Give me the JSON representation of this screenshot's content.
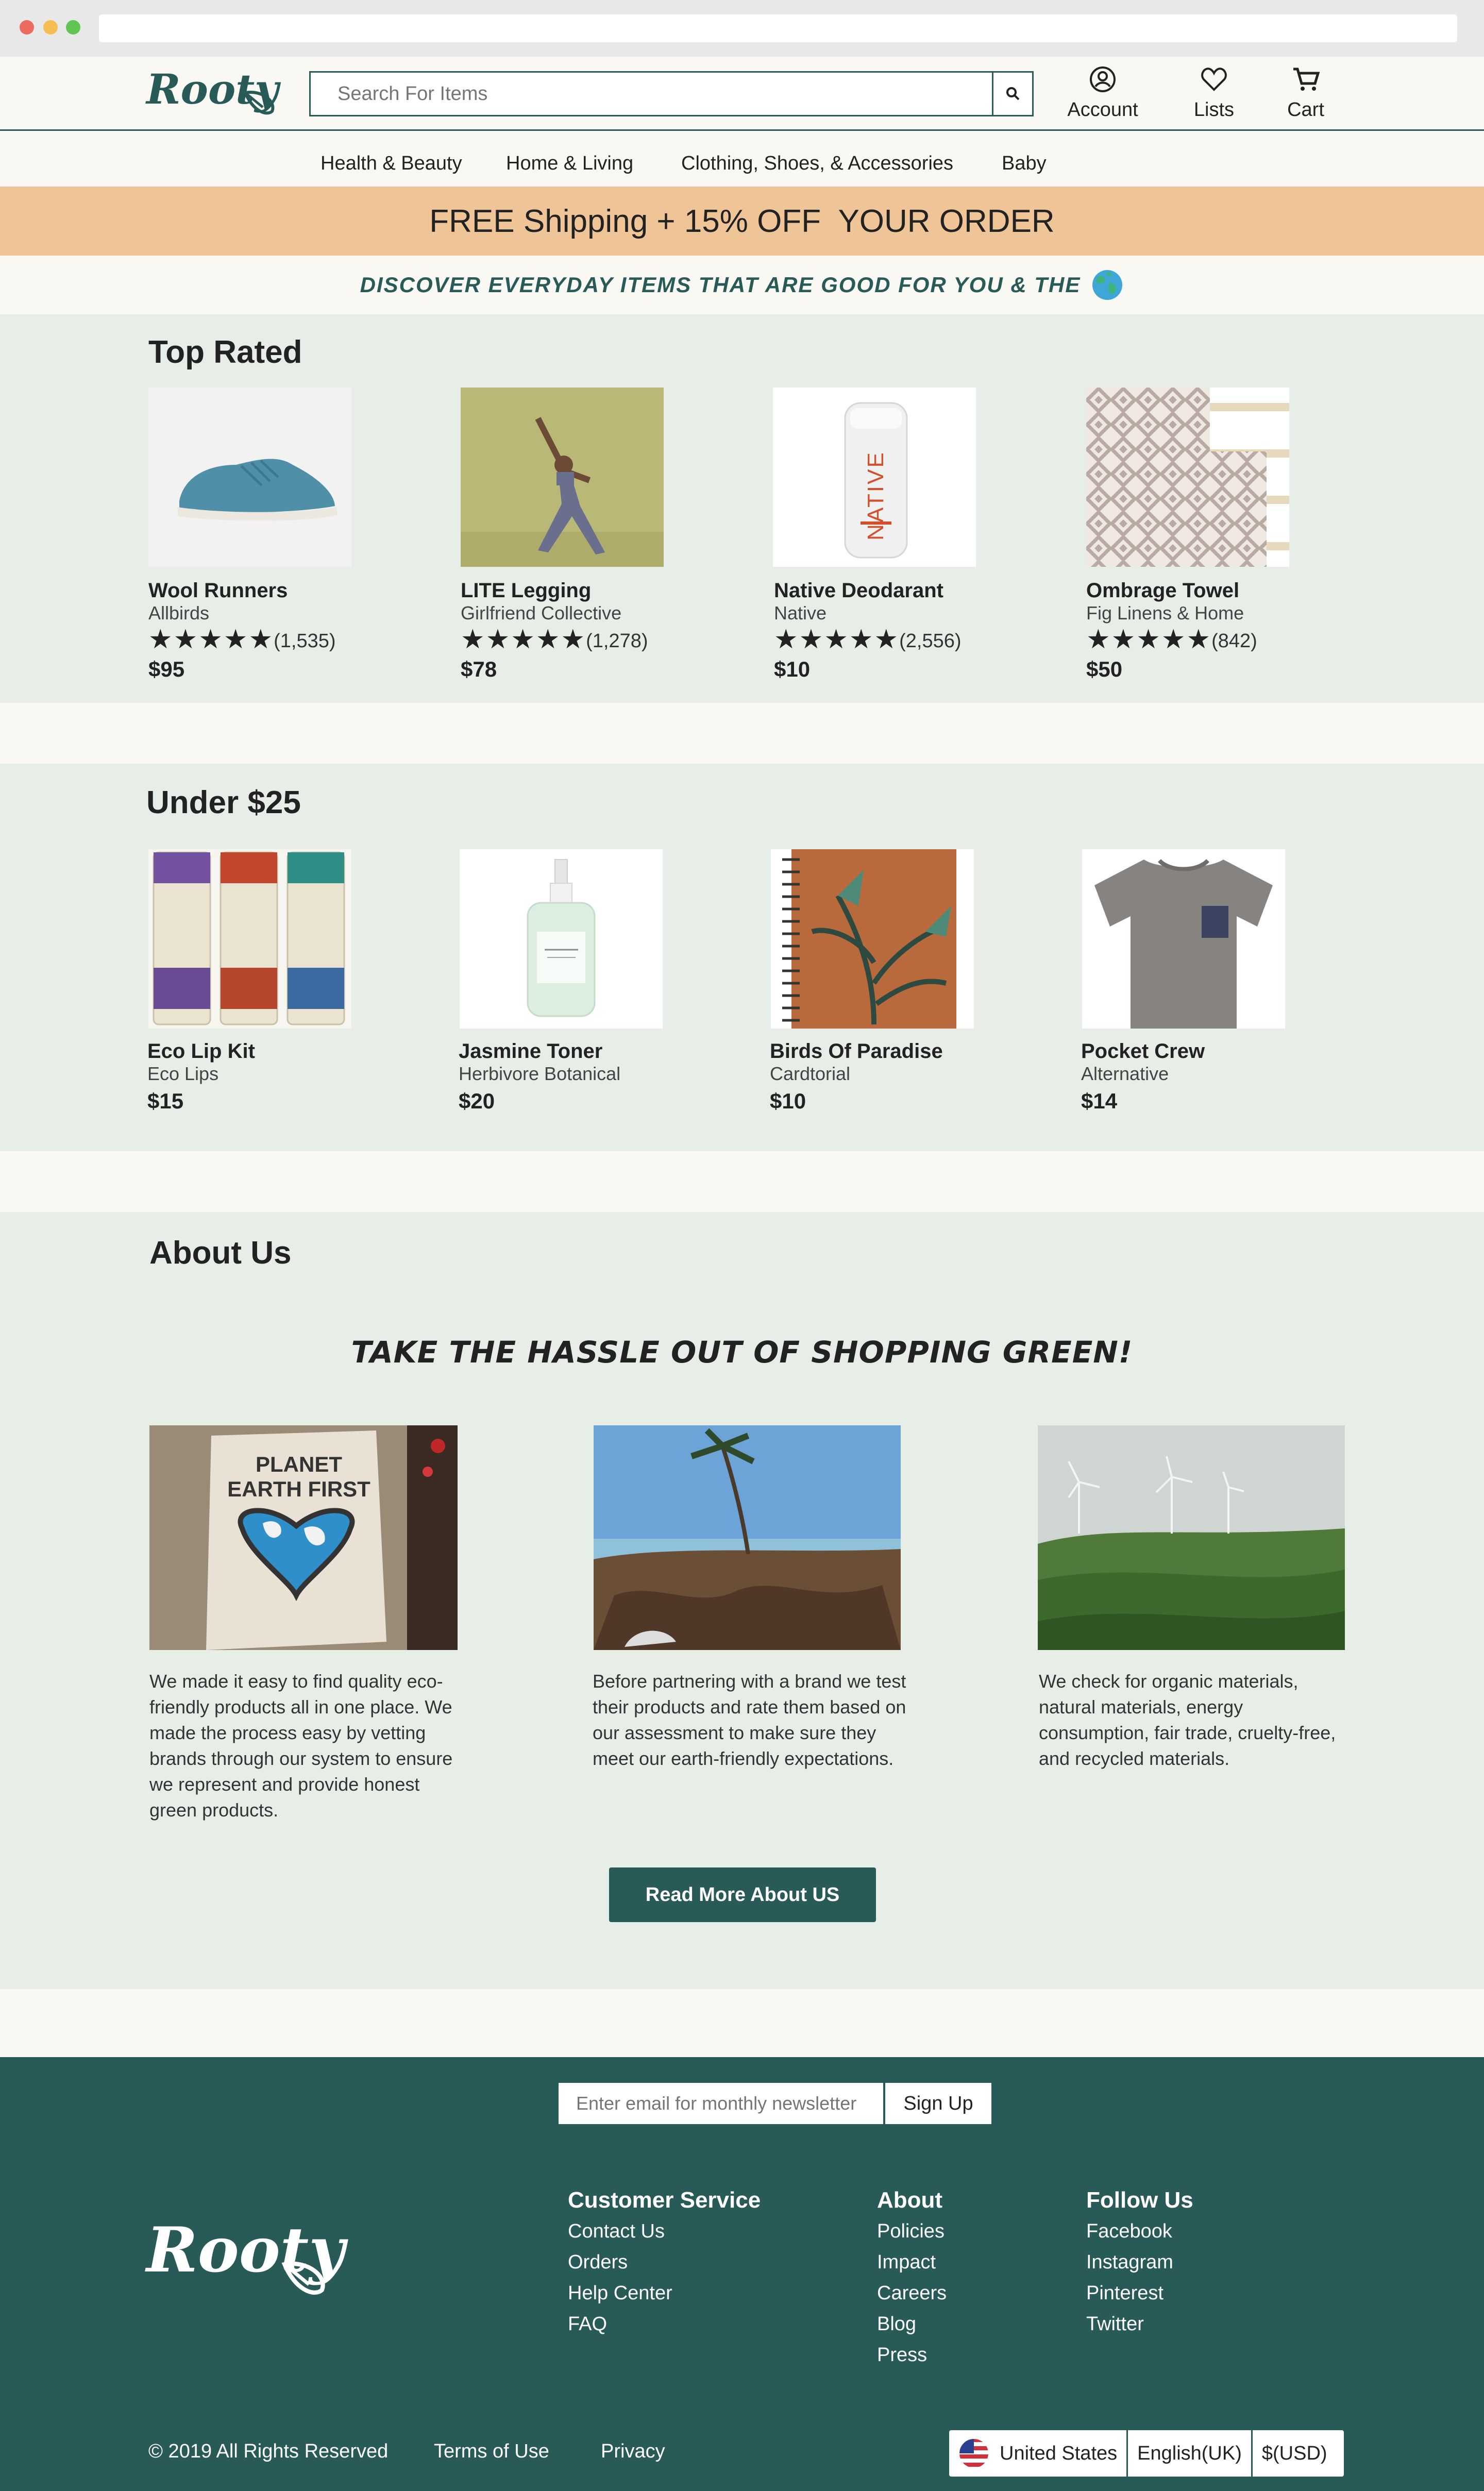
{
  "colors": {
    "brand": "#285a58",
    "banner": "#efc497",
    "section_bg": "#e7eee8",
    "page_bg": "#faf8f2"
  },
  "header": {
    "logo": "Rooty",
    "search_placeholder": "Search For Items",
    "account_label": "Account",
    "lists_label": "Lists",
    "cart_label": "Cart"
  },
  "nav": {
    "items": [
      "Health & Beauty",
      "Home & Living",
      "Clothing, Shoes, & Accessories",
      "Baby"
    ]
  },
  "banner": {
    "text": "FREE Shipping + 15% OFF  YOUR ORDER"
  },
  "discover": {
    "text": "DISCOVER EVERYDAY ITEMS THAT ARE GOOD FOR YOU & THE"
  },
  "top_rated": {
    "title": "Top Rated",
    "products": [
      {
        "name": "Wool Runners",
        "brand": "Allbirds",
        "stars": "★★★★★",
        "reviews": "(1,535)",
        "price": "$95"
      },
      {
        "name": "LITE Legging",
        "brand": "Girlfriend Collective",
        "stars": "★★★★★",
        "reviews": "(1,278)",
        "price": "$78"
      },
      {
        "name": "Native Deodarant",
        "brand": "Native",
        "stars": "★★★★★",
        "reviews": "(2,556)",
        "price": "$10"
      },
      {
        "name": "Ombrage Towel",
        "brand": "Fig Linens & Home",
        "stars": "★★★★★",
        "reviews": "(842)",
        "price": "$50"
      }
    ]
  },
  "under25": {
    "title": "Under $25",
    "products": [
      {
        "name": "Eco Lip Kit",
        "brand": "Eco Lips",
        "price": "$15"
      },
      {
        "name": "Jasmine Toner",
        "brand": "Herbivore Botanical",
        "price": "$20"
      },
      {
        "name": "Birds Of Paradise",
        "brand": "Cardtorial",
        "price": "$10"
      },
      {
        "name": "Pocket Crew",
        "brand": "Alternative",
        "price": "$14"
      }
    ]
  },
  "about": {
    "title": "About Us",
    "tagline": "TAKE THE HASSLE OUT OF SHOPPING GREEN!",
    "poster_line1": "PLANET",
    "poster_line2": "EARTH FIRST",
    "columns": [
      "We made it easy to find quality eco-friendly products all in one place. We made the process easy by vetting brands through our system to ensure we represent and provide honest green products.",
      "Before partnering with a brand we test their products and rate them based on our assessment to make sure they meet our earth-friendly expectations.",
      "We check for organic materials, natural materials, energy consumption, fair trade, cruelty-free, and recycled materials."
    ],
    "button": "Read More About US"
  },
  "footer": {
    "newsletter_placeholder": "Enter email for monthly newsletter",
    "signup": "Sign Up",
    "logo": "Rooty",
    "customer_service": {
      "title": "Customer Service",
      "links": [
        "Contact Us",
        "Orders",
        "Help Center",
        "FAQ"
      ]
    },
    "about": {
      "title": "About",
      "links": [
        "Policies",
        "Impact",
        "Careers",
        "Blog",
        "Press"
      ]
    },
    "follow": {
      "title": "Follow Us",
      "links": [
        "Facebook",
        "Instagram",
        "Pinterest",
        "Twitter"
      ]
    },
    "copyright": "© 2019 All Rights Reserved",
    "terms": "Terms of Use",
    "privacy": "Privacy",
    "country": "United States",
    "language": "English(UK)",
    "currency": "$(USD)"
  }
}
